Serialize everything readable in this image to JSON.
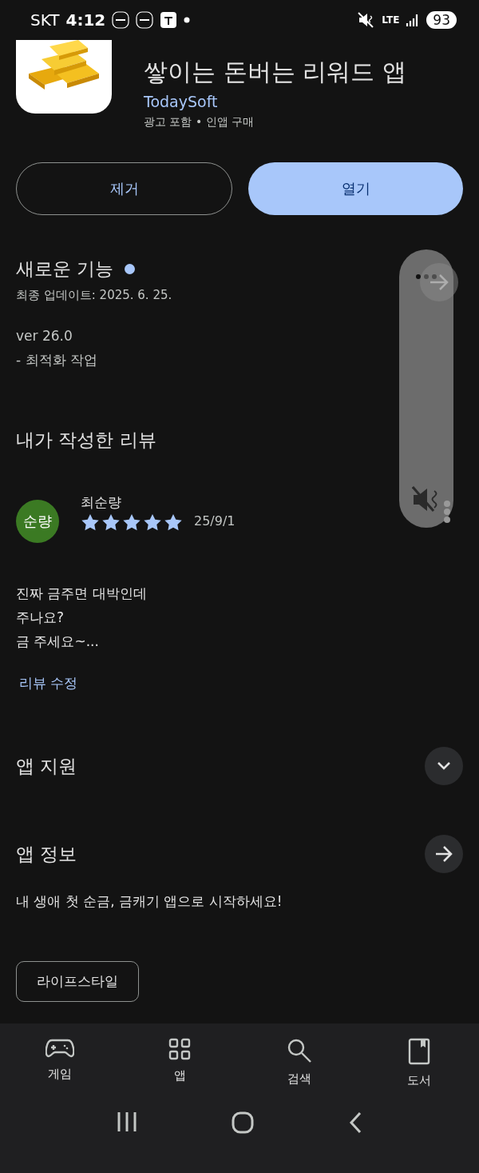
{
  "status_bar": {
    "carrier": "SKT",
    "time": "4:12",
    "network": "LTE",
    "battery": "93"
  },
  "app": {
    "title": "쌓이는 돈버는 리워드 앱",
    "developer": "TodaySoft",
    "meta": "광고 포함 • 인앱 구매"
  },
  "buttons": [
    {
      "label": "제거",
      "kind": "outline"
    },
    {
      "label": "열기",
      "kind": "filled"
    }
  ],
  "whats_new": {
    "title": "새로운 기능",
    "new": true,
    "updated": "최종 업데이트: 2025. 6. 25.",
    "lines": [
      "ver 26.0",
      "- 최적화 작업"
    ]
  },
  "my_review": {
    "title": "내가 작성한 리뷰",
    "avatar": "순량",
    "author": "최순량",
    "stars": 5,
    "date": "25/9/1",
    "lines": [
      "진짜 금주면 대박인데",
      "주나요?",
      "금 주세요~..."
    ],
    "edit_link": "리뷰 수정"
  },
  "app_support": {
    "title": "앱 지원",
    "expanded": false
  },
  "app_info": {
    "title": "앱 정보",
    "description": "내 생애 첫 순금, 금캐기 앱으로 시작하세요!",
    "tag": "라이프스타일"
  },
  "bottom_nav": [
    {
      "label": "게임",
      "kind": "games"
    },
    {
      "label": "앱",
      "kind": "apps"
    },
    {
      "label": "검색",
      "kind": "search"
    },
    {
      "label": "도서",
      "kind": "books"
    }
  ]
}
